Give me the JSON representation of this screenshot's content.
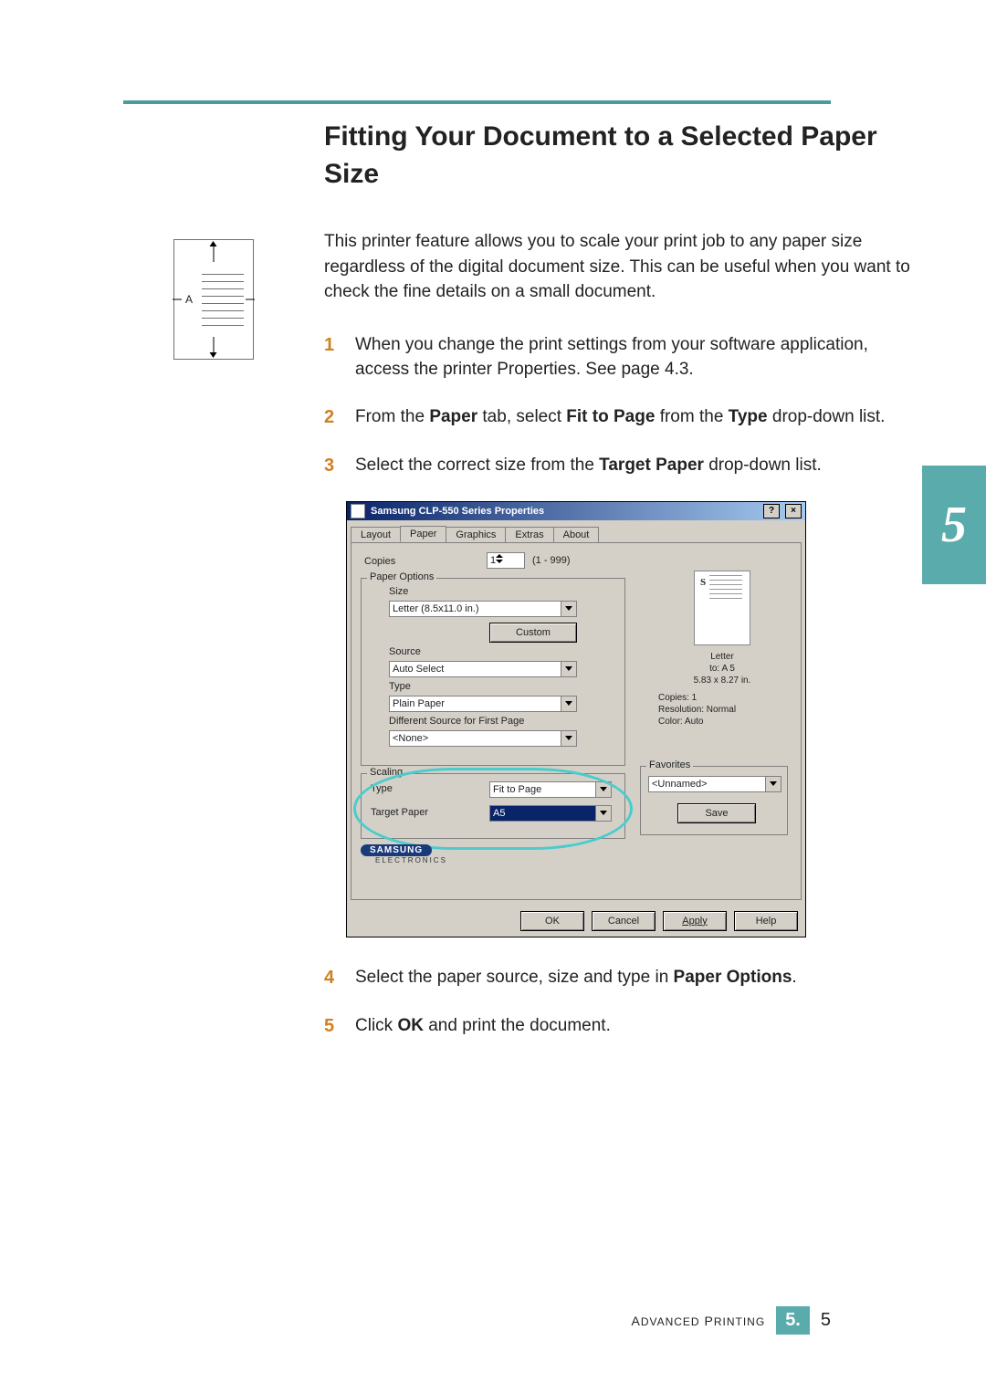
{
  "sideTab": "5",
  "heading": "Fitting Your Document to a Selected Paper Size",
  "intro": "This printer feature allows you to scale your print job to any paper size regardless of the digital document size. This can be useful when you want to check the fine details on a small document.",
  "iconLetter": "A",
  "steps": {
    "s1": "When you change the print settings from your software application, access the printer Properties. See page 4.3.",
    "s2_a": "From the ",
    "s2_b": "Paper",
    "s2_c": " tab, select ",
    "s2_d": "Fit to Page",
    "s2_e": " from the ",
    "s2_f": "Type",
    "s2_g": " drop-down list.",
    "s3_a": "Select the correct size from the ",
    "s3_b": "Target Paper",
    "s3_c": " drop-down list.",
    "s4_a": "Select the paper source, size and type in ",
    "s4_b": "Paper Options",
    "s4_c": ".",
    "s5_a": "Click ",
    "s5_b": "OK",
    "s5_c": " and print the document."
  },
  "dlg": {
    "title": "Samsung CLP-550 Series Properties",
    "helpBtn": "?",
    "closeBtn": "×",
    "tabs": [
      "Layout",
      "Paper",
      "Graphics",
      "Extras",
      "About"
    ],
    "activeTab": 1,
    "copiesLabel": "Copies",
    "copiesValue": "1",
    "copiesRange": "(1 - 999)",
    "paperOptions": {
      "legend": "Paper Options",
      "sizeLabel": "Size",
      "sizeValue": "Letter (8.5x11.0 in.)",
      "customBtn": "Custom",
      "sourceLabel": "Source",
      "sourceValue": "Auto Select",
      "typeLabel": "Type",
      "typeValue": "Plain Paper",
      "diffSourceLabel": "Different Source for First Page",
      "diffSourceValue": "<None>"
    },
    "scaling": {
      "legend": "Scaling",
      "typeLabel": "Type",
      "typeValue": "Fit to Page",
      "targetLabel": "Target Paper",
      "targetValue": "A5"
    },
    "preview": {
      "s": "S",
      "line1": "Letter",
      "line2": "to: A 5",
      "line3": "5.83 x 8.27 in.",
      "copies": "Copies: 1",
      "res": "Resolution: Normal",
      "color": "Color: Auto"
    },
    "favorites": {
      "legend": "Favorites",
      "value": "<Unnamed>",
      "save": "Save"
    },
    "brand": "SAMSUNG",
    "brandSub": "ELECTRONICS",
    "buttons": {
      "ok": "OK",
      "cancel": "Cancel",
      "apply": "Apply",
      "help": "Help"
    }
  },
  "footer": {
    "section": "Advanced Printing",
    "chapter": "5.",
    "page": "5"
  }
}
